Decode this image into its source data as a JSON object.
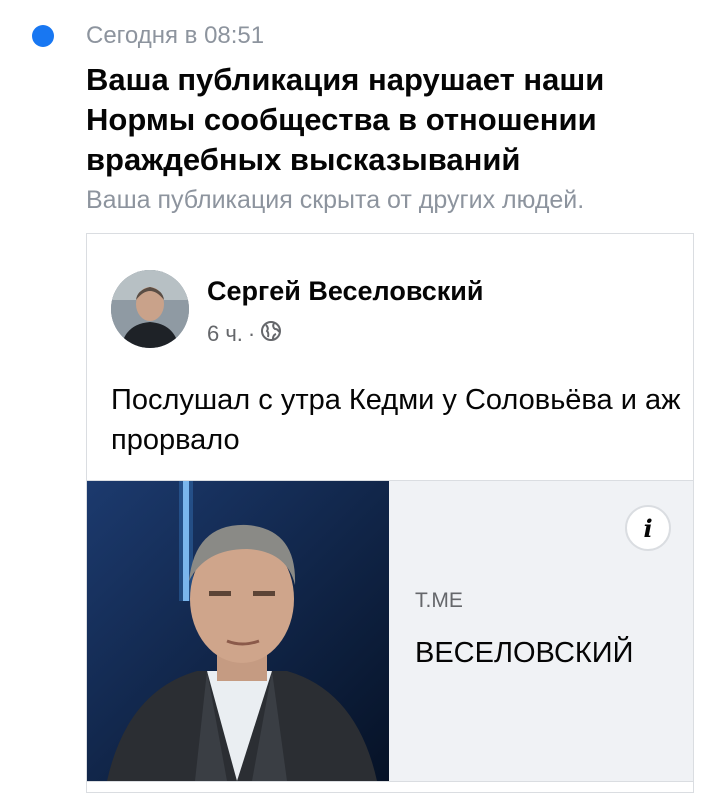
{
  "notification": {
    "timestamp": "Сегодня в 08:51",
    "title": "Ваша публикация нарушает наши Нормы сообщества в отношении враждебных высказываний",
    "subtitle": "Ваша публикация скрыта от других людей.",
    "unread_color": "#1877f2"
  },
  "post": {
    "author": "Сергей Веселовский",
    "time": "6 ч.",
    "separator": "·",
    "audience_icon": "globe-icon",
    "text": "Послушал с утра Кедми у Соловьёва и аж прорвало",
    "link": {
      "domain": "T.ME",
      "title": "ВЕСЕЛОВСКИЙ",
      "info_icon": "i"
    }
  }
}
